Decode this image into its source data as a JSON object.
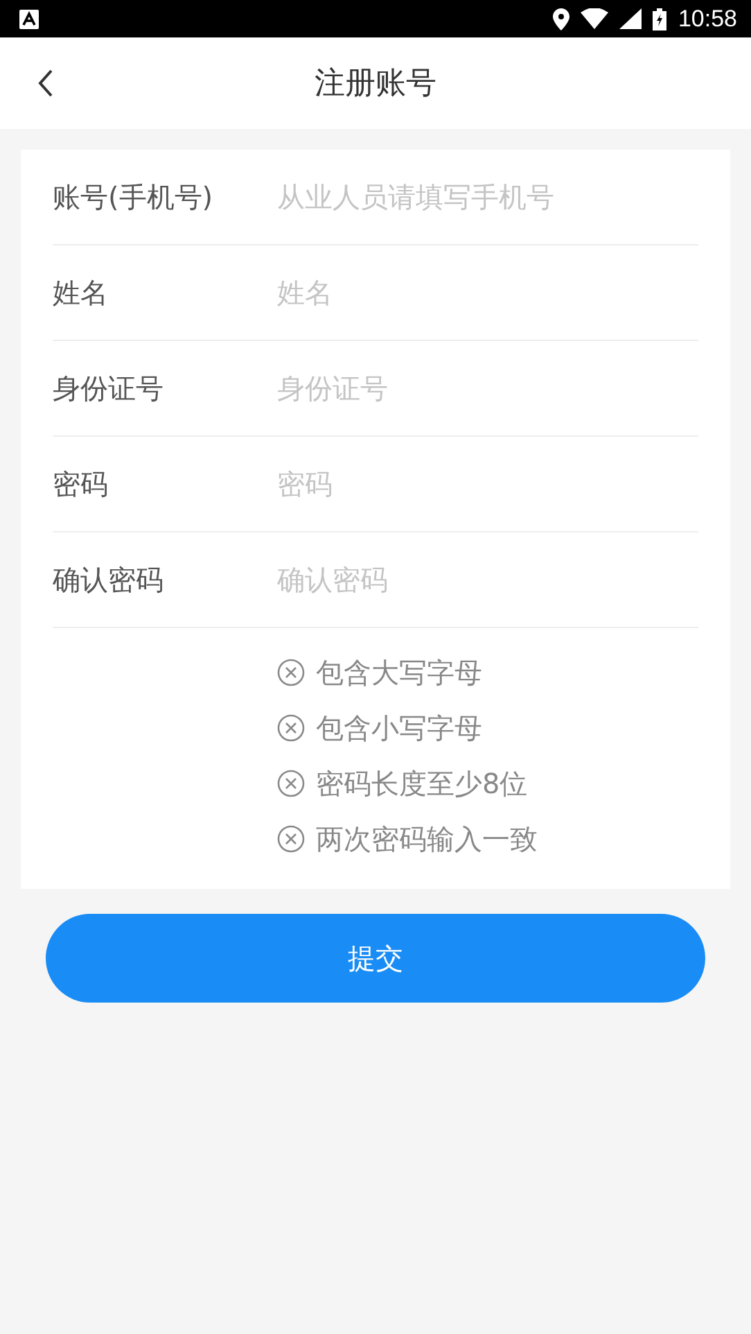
{
  "status_bar": {
    "time": "10:58"
  },
  "header": {
    "title": "注册账号"
  },
  "fields": [
    {
      "label": "账号(手机号)",
      "placeholder": "从业人员请填写手机号"
    },
    {
      "label": "姓名",
      "placeholder": "姓名"
    },
    {
      "label": "身份证号",
      "placeholder": "身份证号"
    },
    {
      "label": "密码",
      "placeholder": "密码"
    },
    {
      "label": "确认密码",
      "placeholder": "确认密码"
    }
  ],
  "password_rules": [
    {
      "text": "包含大写字母",
      "met": false
    },
    {
      "text": "包含小写字母",
      "met": false
    },
    {
      "text": "密码长度至少8位",
      "met": false
    },
    {
      "text": "两次密码输入一致",
      "met": false
    }
  ],
  "submit_button": "提交"
}
